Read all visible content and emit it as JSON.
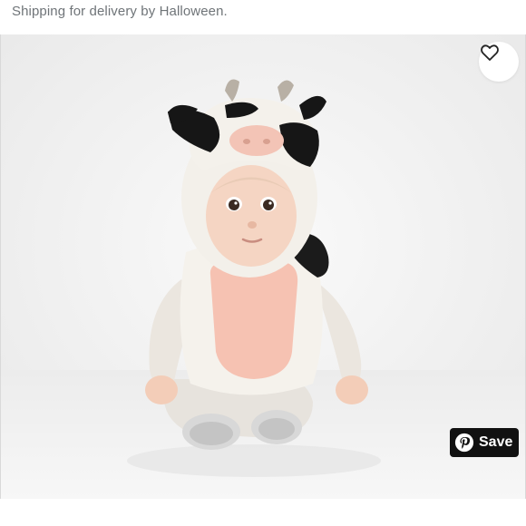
{
  "listing": {
    "shipping_note": "Shipping for delivery by Halloween."
  },
  "product_image": {
    "description_icon": "baby-cow-costume-photo"
  },
  "actions": {
    "favorite_icon": "heart-icon",
    "save_label": "Save",
    "save_icon": "pinterest-icon",
    "save_color": "#111111"
  }
}
